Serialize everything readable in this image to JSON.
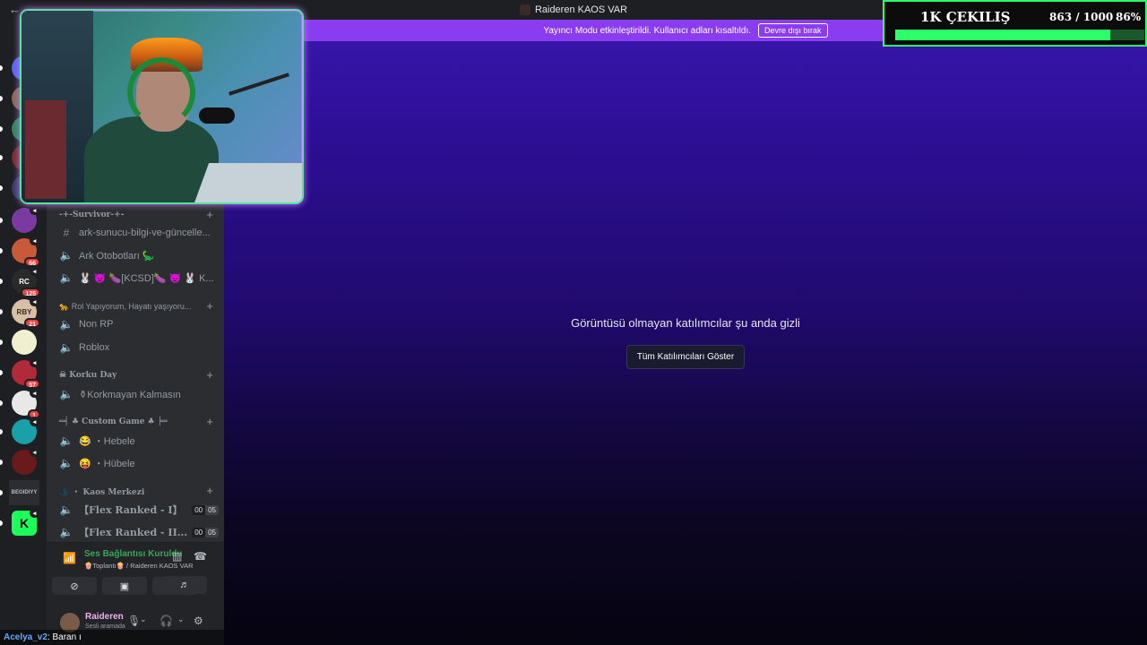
{
  "window": {
    "title": "Raideren KAOS VAR",
    "back_glyph": "←"
  },
  "banner": {
    "text": "Yayıncı Modu etkinleştirildi. Kullanıcı adları kısaltıldı.",
    "button": "Devre dışı bırak"
  },
  "guilds": [
    {
      "label": "",
      "color": "#5865f2",
      "badge": "",
      "speaker": false
    },
    {
      "label": "",
      "color": "#8a6a5a",
      "badge": "",
      "speaker": false
    },
    {
      "label": "",
      "color": "#2b8a5a",
      "badge": "",
      "speaker": false
    },
    {
      "label": "",
      "color": "#7a2a2a",
      "badge": "",
      "speaker": false
    },
    {
      "label": "",
      "color": "#3a3a6a",
      "badge": "",
      "speaker": true
    },
    {
      "label": "",
      "color": "#7a3aa0",
      "badge": "",
      "speaker": true
    },
    {
      "label": "",
      "color": "#c85a3a",
      "badge": "66",
      "speaker": true
    },
    {
      "label": "RC",
      "color": "#2a2a2a",
      "badge": "125",
      "speaker": true
    },
    {
      "label": "RBY",
      "color": "#d8c0a8",
      "badge": "21",
      "speaker": true
    },
    {
      "label": "",
      "color": "#f0f0d0",
      "badge": "",
      "speaker": false
    },
    {
      "label": "",
      "color": "#b02a3a",
      "badge": "57",
      "speaker": true
    },
    {
      "label": "",
      "color": "#e8e8e8",
      "badge": "1",
      "speaker": true
    },
    {
      "label": "",
      "color": "#1aa0a8",
      "badge": "",
      "speaker": true
    },
    {
      "label": "",
      "color": "#6a1a1a",
      "badge": "",
      "speaker": true
    },
    {
      "label": "BEGIDIYY",
      "color": "#2b2d31",
      "badge": "",
      "speaker": false
    },
    {
      "label": "K",
      "color": "#1aff5a",
      "badge": "",
      "speaker": true
    }
  ],
  "channels": {
    "survivor": {
      "title": "-+-Survivor-+-",
      "items": [
        {
          "name": "ark-sunucu-bilgi-ve-güncelle...",
          "icon": "hash-icon"
        },
        {
          "name": "Ark Otobotları 🦕",
          "icon": "speaker-icon"
        },
        {
          "name": "🐰 👿 🍆[KCSD]🍆 👿 🐰 K...",
          "icon": "speaker-icon"
        }
      ]
    },
    "rol": {
      "title": "🐆 Rol Yapıyorum, Hayatı yaşıyoru...",
      "items": [
        {
          "name": "Non RP",
          "icon": "speaker-icon"
        },
        {
          "name": "Roblox",
          "icon": "speaker-icon"
        }
      ]
    },
    "korku": {
      "title": "☠ Korku Day",
      "items": [
        {
          "name": "⚱Korkmayan Kalmasın",
          "icon": "speaker-icon"
        }
      ]
    },
    "custom": {
      "title": "═╡ ♣ Custom Game ♣ ╞═",
      "items": [
        {
          "name": "😂 ・Hebele",
          "icon": "speaker-icon"
        },
        {
          "name": "😝 ・Hübele",
          "icon": "speaker-icon"
        }
      ]
    },
    "kaos": {
      "title": "🌑 ・ Kaos Merkezi",
      "items": [
        {
          "name": "【Flex Ranked - I】",
          "icon": "speaker-icon",
          "c1": "00",
          "c2": "05"
        },
        {
          "name": "【Flex Ranked - II...",
          "icon": "speaker-icon",
          "c1": "00",
          "c2": "05"
        }
      ]
    }
  },
  "voice": {
    "status": "Ses Bağlantısı Kuruldu",
    "sub": "🍿Toplantı🍿 / Raideren KAOS VAR"
  },
  "user": {
    "name": "Raideren",
    "status": "Sesli aramada"
  },
  "chat": {
    "name": "Acelya_v2",
    "message": " : Baran ı"
  },
  "stage": {
    "message": "Görüntüsü olmayan katılımcılar şu anda gizli",
    "button": "Tüm Katılımcıları Göster"
  },
  "goal": {
    "title": "1K ÇEKILIŞ",
    "count": "863 / 1000",
    "percent": "86%",
    "progress": 0.863
  }
}
